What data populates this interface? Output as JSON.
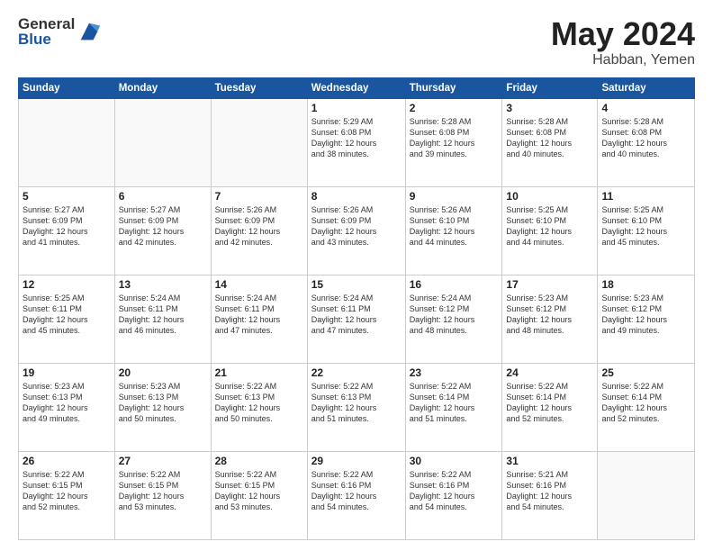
{
  "logo": {
    "general": "General",
    "blue": "Blue"
  },
  "title": {
    "month_year": "May 2024",
    "location": "Habban, Yemen"
  },
  "weekdays": [
    "Sunday",
    "Monday",
    "Tuesday",
    "Wednesday",
    "Thursday",
    "Friday",
    "Saturday"
  ],
  "weeks": [
    [
      {
        "day": "",
        "info": ""
      },
      {
        "day": "",
        "info": ""
      },
      {
        "day": "",
        "info": ""
      },
      {
        "day": "1",
        "info": "Sunrise: 5:29 AM\nSunset: 6:08 PM\nDaylight: 12 hours\nand 38 minutes."
      },
      {
        "day": "2",
        "info": "Sunrise: 5:28 AM\nSunset: 6:08 PM\nDaylight: 12 hours\nand 39 minutes."
      },
      {
        "day": "3",
        "info": "Sunrise: 5:28 AM\nSunset: 6:08 PM\nDaylight: 12 hours\nand 40 minutes."
      },
      {
        "day": "4",
        "info": "Sunrise: 5:28 AM\nSunset: 6:08 PM\nDaylight: 12 hours\nand 40 minutes."
      }
    ],
    [
      {
        "day": "5",
        "info": "Sunrise: 5:27 AM\nSunset: 6:09 PM\nDaylight: 12 hours\nand 41 minutes."
      },
      {
        "day": "6",
        "info": "Sunrise: 5:27 AM\nSunset: 6:09 PM\nDaylight: 12 hours\nand 42 minutes."
      },
      {
        "day": "7",
        "info": "Sunrise: 5:26 AM\nSunset: 6:09 PM\nDaylight: 12 hours\nand 42 minutes."
      },
      {
        "day": "8",
        "info": "Sunrise: 5:26 AM\nSunset: 6:09 PM\nDaylight: 12 hours\nand 43 minutes."
      },
      {
        "day": "9",
        "info": "Sunrise: 5:26 AM\nSunset: 6:10 PM\nDaylight: 12 hours\nand 44 minutes."
      },
      {
        "day": "10",
        "info": "Sunrise: 5:25 AM\nSunset: 6:10 PM\nDaylight: 12 hours\nand 44 minutes."
      },
      {
        "day": "11",
        "info": "Sunrise: 5:25 AM\nSunset: 6:10 PM\nDaylight: 12 hours\nand 45 minutes."
      }
    ],
    [
      {
        "day": "12",
        "info": "Sunrise: 5:25 AM\nSunset: 6:11 PM\nDaylight: 12 hours\nand 45 minutes."
      },
      {
        "day": "13",
        "info": "Sunrise: 5:24 AM\nSunset: 6:11 PM\nDaylight: 12 hours\nand 46 minutes."
      },
      {
        "day": "14",
        "info": "Sunrise: 5:24 AM\nSunset: 6:11 PM\nDaylight: 12 hours\nand 47 minutes."
      },
      {
        "day": "15",
        "info": "Sunrise: 5:24 AM\nSunset: 6:11 PM\nDaylight: 12 hours\nand 47 minutes."
      },
      {
        "day": "16",
        "info": "Sunrise: 5:24 AM\nSunset: 6:12 PM\nDaylight: 12 hours\nand 48 minutes."
      },
      {
        "day": "17",
        "info": "Sunrise: 5:23 AM\nSunset: 6:12 PM\nDaylight: 12 hours\nand 48 minutes."
      },
      {
        "day": "18",
        "info": "Sunrise: 5:23 AM\nSunset: 6:12 PM\nDaylight: 12 hours\nand 49 minutes."
      }
    ],
    [
      {
        "day": "19",
        "info": "Sunrise: 5:23 AM\nSunset: 6:13 PM\nDaylight: 12 hours\nand 49 minutes."
      },
      {
        "day": "20",
        "info": "Sunrise: 5:23 AM\nSunset: 6:13 PM\nDaylight: 12 hours\nand 50 minutes."
      },
      {
        "day": "21",
        "info": "Sunrise: 5:22 AM\nSunset: 6:13 PM\nDaylight: 12 hours\nand 50 minutes."
      },
      {
        "day": "22",
        "info": "Sunrise: 5:22 AM\nSunset: 6:13 PM\nDaylight: 12 hours\nand 51 minutes."
      },
      {
        "day": "23",
        "info": "Sunrise: 5:22 AM\nSunset: 6:14 PM\nDaylight: 12 hours\nand 51 minutes."
      },
      {
        "day": "24",
        "info": "Sunrise: 5:22 AM\nSunset: 6:14 PM\nDaylight: 12 hours\nand 52 minutes."
      },
      {
        "day": "25",
        "info": "Sunrise: 5:22 AM\nSunset: 6:14 PM\nDaylight: 12 hours\nand 52 minutes."
      }
    ],
    [
      {
        "day": "26",
        "info": "Sunrise: 5:22 AM\nSunset: 6:15 PM\nDaylight: 12 hours\nand 52 minutes."
      },
      {
        "day": "27",
        "info": "Sunrise: 5:22 AM\nSunset: 6:15 PM\nDaylight: 12 hours\nand 53 minutes."
      },
      {
        "day": "28",
        "info": "Sunrise: 5:22 AM\nSunset: 6:15 PM\nDaylight: 12 hours\nand 53 minutes."
      },
      {
        "day": "29",
        "info": "Sunrise: 5:22 AM\nSunset: 6:16 PM\nDaylight: 12 hours\nand 54 minutes."
      },
      {
        "day": "30",
        "info": "Sunrise: 5:22 AM\nSunset: 6:16 PM\nDaylight: 12 hours\nand 54 minutes."
      },
      {
        "day": "31",
        "info": "Sunrise: 5:21 AM\nSunset: 6:16 PM\nDaylight: 12 hours\nand 54 minutes."
      },
      {
        "day": "",
        "info": ""
      }
    ]
  ]
}
